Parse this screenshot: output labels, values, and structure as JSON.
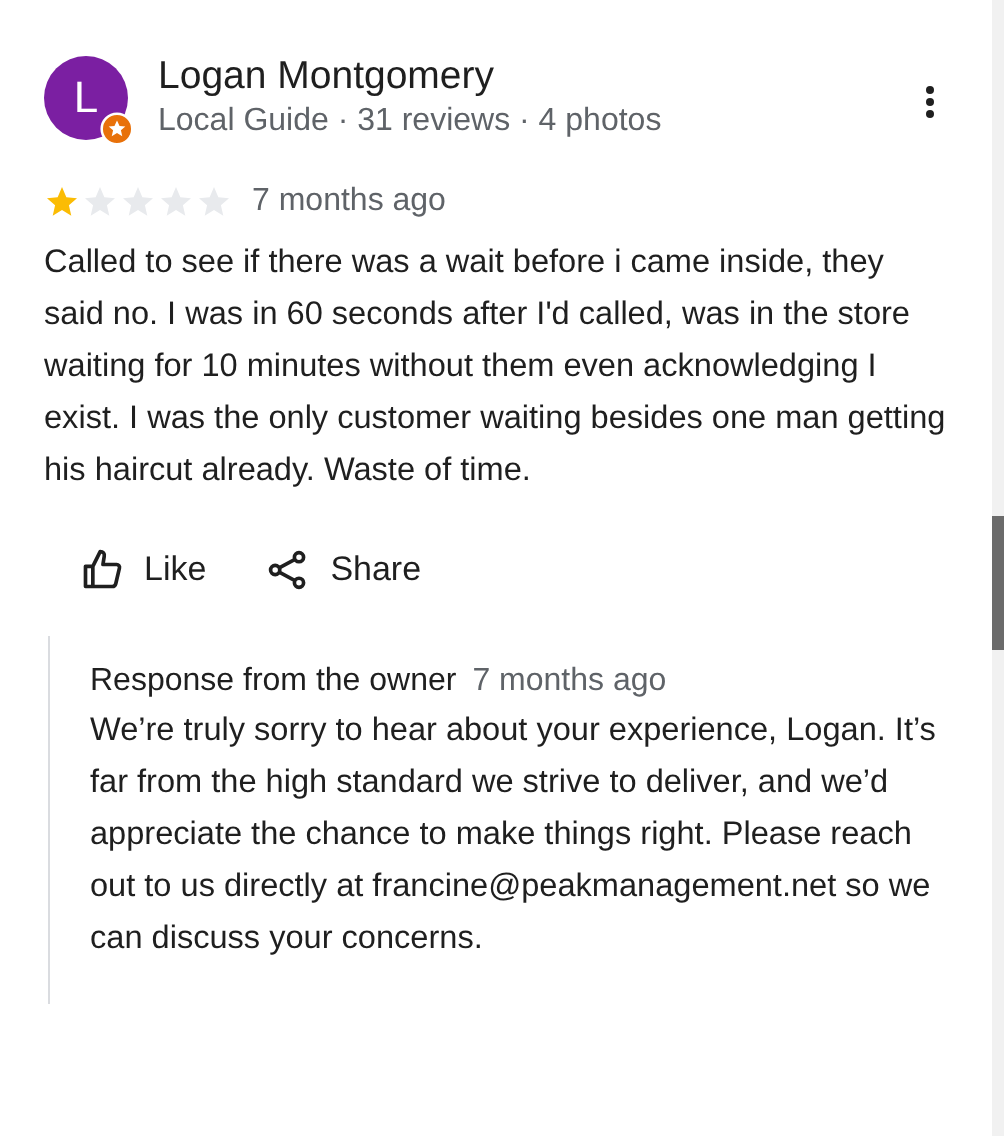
{
  "review": {
    "author": "Logan Montgomery",
    "avatar_letter": "L",
    "local_guide_badge": true,
    "meta": "Local Guide · 31 reviews · 4 photos",
    "stars": 1,
    "time": "7 months ago",
    "text": "Called to see if there was a wait before i came inside, they said no. I was in 60 seconds after I'd called, was in the store waiting for 10 minutes without them even acknowledging I exist. I was the only customer waiting besides one man getting his haircut already. Waste of time.",
    "actions": [
      {
        "kind": "like",
        "label": "Like"
      },
      {
        "kind": "share",
        "label": "Share"
      }
    ],
    "owner_response": {
      "title": "Response from the owner",
      "time": "7 months ago",
      "text": "We’re truly sorry to hear about your experience, Logan. It’s far from the high standard we strive to deliver, and we’d appreciate the chance to make things right. Please reach out to us directly at francine@peakmanagement.net so we can discuss your concerns."
    }
  }
}
